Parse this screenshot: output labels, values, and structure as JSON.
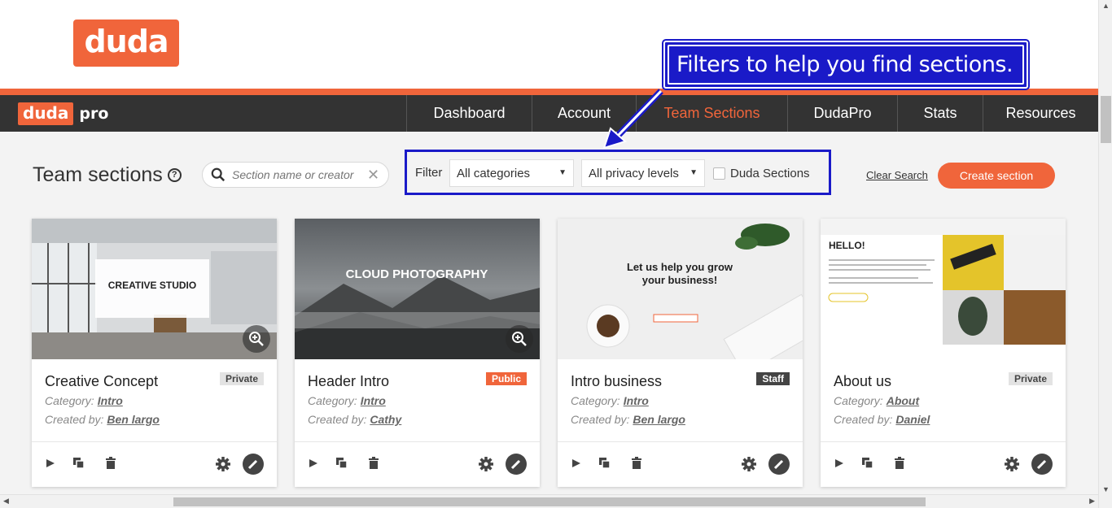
{
  "logo_text": "duda",
  "brand": {
    "name": "duda",
    "suffix": "pro"
  },
  "nav": [
    {
      "label": "Dashboard",
      "active": false
    },
    {
      "label": "Account",
      "active": false
    },
    {
      "label": "Team Sections",
      "active": true
    },
    {
      "label": "DudaPro",
      "active": false
    },
    {
      "label": "Stats",
      "active": false
    },
    {
      "label": "Resources",
      "active": false
    }
  ],
  "page": {
    "title": "Team sections",
    "help_glyph": "?"
  },
  "search": {
    "placeholder": "Section name or creator",
    "clear_glyph": "✕"
  },
  "filter": {
    "label": "Filter",
    "category": "All categories",
    "privacy": "All privacy levels",
    "duda_sections": "Duda Sections",
    "duda_sections_checked": false
  },
  "clear_search": "Clear Search",
  "create_button": "Create section",
  "callout": "Filters to help you find sections.",
  "labels": {
    "category": "Category:",
    "created_by": "Created by:"
  },
  "cards": [
    {
      "name": "Creative Concept",
      "badge": "Private",
      "badge_type": "private",
      "category": "Intro",
      "creator": "Ben largo",
      "thumb_text": "CREATIVE STUDIO"
    },
    {
      "name": "Header Intro",
      "badge": "Public",
      "badge_type": "public",
      "category": "Intro",
      "creator": "Cathy",
      "thumb_text": "CLOUD PHOTOGRAPHY"
    },
    {
      "name": "Intro business",
      "badge": "Staff",
      "badge_type": "staff",
      "category": "Intro",
      "creator": "Ben largo",
      "thumb_text": "Let us help you grow your business!"
    },
    {
      "name": "About us",
      "badge": "Private",
      "badge_type": "private",
      "category": "About",
      "creator": "Daniel",
      "thumb_text": "HELLO!"
    }
  ],
  "colors": {
    "brand_orange": "#f0653b",
    "nav_bg": "#333333",
    "callout_blue": "#1a1ac8"
  }
}
